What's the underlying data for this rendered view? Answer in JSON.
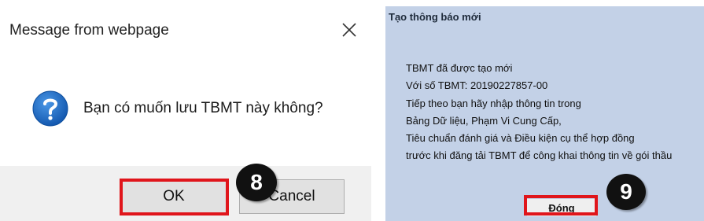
{
  "left_dialog": {
    "title": "Message from webpage",
    "message": "Bạn có muốn lưu TBMT này không?",
    "ok_label": "OK",
    "cancel_label": "Cancel",
    "icons": {
      "close": "close-icon",
      "question": "question-icon"
    }
  },
  "right_dialog": {
    "title": "Tạo thông báo mới",
    "lines": [
      "TBMT đã được tạo mới",
      "Với số TBMT: 20190227857-00",
      "Tiếp theo bạn hãy nhập thông tin trong",
      "Bảng Dữ liệu, Phạm Vi Cung Cấp,",
      "Tiêu chuẩn đánh giá và Điều kiện cụ thể hợp đồng",
      "trước khi đăng tải TBMT để công khai thông tin về gói thầu"
    ],
    "close_label": "Đóng"
  },
  "annotations": {
    "step_8": "8",
    "step_9": "9",
    "highlight_color": "#e0151b"
  },
  "colors": {
    "question_icon_blue": "#1f6fc5",
    "right_dialog_bg": "#c3d1e7",
    "button_bar_bg": "#f0f0f0"
  }
}
